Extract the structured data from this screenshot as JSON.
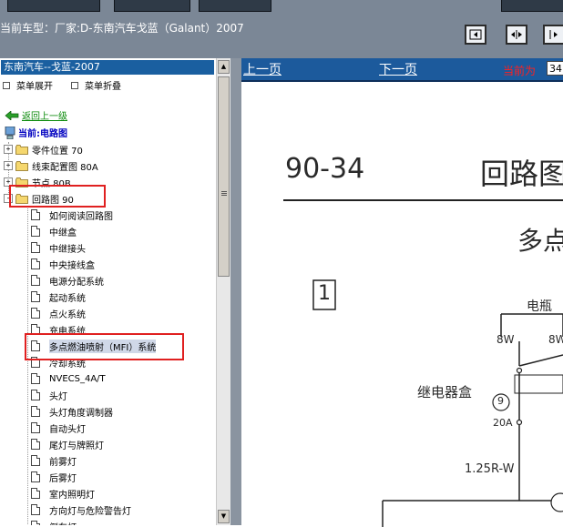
{
  "window": {
    "info_text": "当前车型：厂家:D-东南汽车戈蓝（Galant）2007",
    "colors": {
      "toolbar": "#7b8796",
      "title_bar": "#1a5fa0",
      "page_bar": "#1c5a9c",
      "highlight": "#e02020"
    }
  },
  "nav_buttons": [
    {
      "icon": "collapse-panel-icon"
    },
    {
      "icon": "split-view-icon"
    },
    {
      "icon": "expand-panel-icon"
    }
  ],
  "sidebar": {
    "title": "东南汽车--戈蓝-2007",
    "expand_all": "菜单展开",
    "collapse_all": "菜单折叠",
    "back": "返回上一级",
    "current": "当前:电路图",
    "top_items": [
      {
        "label": "零件位置 70",
        "toggle": "+"
      },
      {
        "label": "线束配置图 80A",
        "toggle": "+"
      },
      {
        "label": "节点 80B",
        "toggle": "+"
      },
      {
        "label": "回路图 90",
        "toggle": "-"
      }
    ],
    "sub_items": [
      "如何阅读回路图",
      "中继盒",
      "中继接头",
      "中央接线盒",
      "电源分配系统",
      "起动系统",
      "点火系统",
      "充电系统",
      "多点燃油喷射（MFI）系统",
      "冷却系统",
      "NVECS_4A/T",
      "头灯",
      "头灯角度调制器",
      "自动头灯",
      "尾灯与牌照灯",
      "前雾灯",
      "后雾灯",
      "室内照明灯",
      "方向灯与危险警告灯",
      "倒车灯"
    ],
    "selected_index": 8
  },
  "pager": {
    "prev": "上一页",
    "next": "下一页",
    "current_label": "当前为",
    "current_value": "34"
  },
  "document": {
    "page_code": "90-34",
    "heading": "回路图",
    "section": "多点",
    "box_number": "1",
    "battery": "电瓶",
    "wire_a": "8W",
    "wire_b": "8W",
    "relay_box": "继电器盒",
    "fuse_no": "9",
    "fuse_rating": "20A",
    "wire_spec": "1.25R-W"
  }
}
